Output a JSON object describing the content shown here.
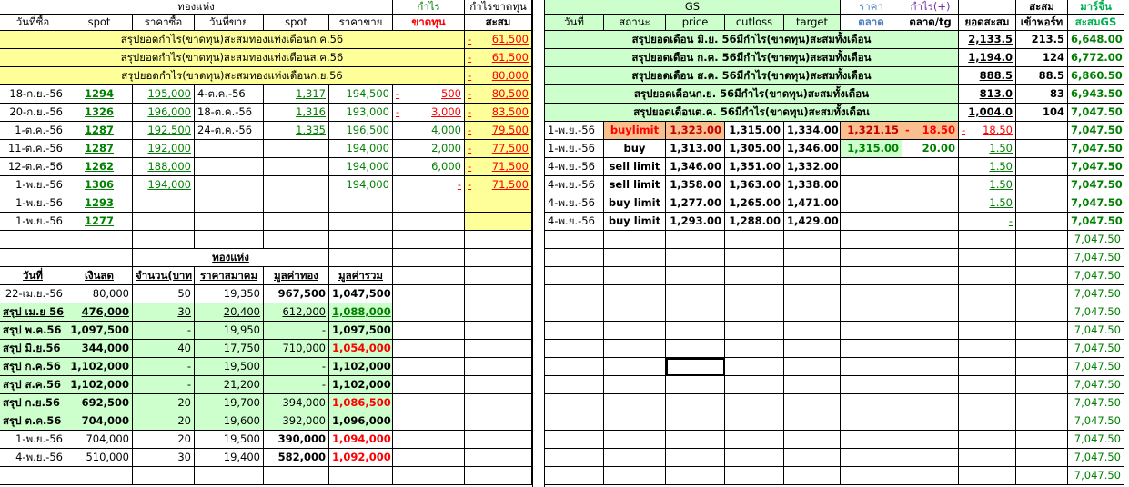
{
  "left": {
    "group_headers": {
      "gold_bar": "ทองแห่ง",
      "profit": "กำไร",
      "profit_loss": "กำไรขาดทุน"
    },
    "headers": [
      "วันที่ซื้อ",
      "spot",
      "ราคาซื้อ",
      "วันที่ขาย",
      "spot",
      "ราคาขาย",
      "ขาดทุน",
      "สะสม"
    ],
    "summaries": [
      {
        "label": "สรุปยอดกำไร(ขาดทุน)สะสมทองแท่งเดือนก.ค.56",
        "dash": "-",
        "value": "61,500"
      },
      {
        "label": "สรุปยอดกำไร(ขาดทุน)สะสมทองแท่งเดือนส.ค.56",
        "dash": "-",
        "value": "61,500"
      },
      {
        "label": "สรุปยอดกำไร(ขาดทุน)สะสมทองแท่งเดือนก.ย.56",
        "dash": "-",
        "value": "80,000"
      }
    ],
    "rows": [
      {
        "buy_date": "18-ก.ย.-56",
        "spot": "1294",
        "buy_price": "195,000",
        "sell_date": "4-ต.ค.-56",
        "sell_spot": "1,317",
        "sell_price": "194,500",
        "pl_dash": "-",
        "pl": "500",
        "cum_dash": "-",
        "cum": "80,500"
      },
      {
        "buy_date": "20-ก.ย.-56",
        "spot": "1326",
        "buy_price": "196,000",
        "sell_date": "18-ต.ค.-56",
        "sell_spot": "1,316",
        "sell_price": "193,000",
        "pl_dash": "-",
        "pl": "3,000",
        "cum_dash": "-",
        "cum": "83,500"
      },
      {
        "buy_date": "1-ต.ค.-56",
        "spot": "1287",
        "buy_price": "192,500",
        "sell_date": "24-ต.ค.-56",
        "sell_spot": "1,335",
        "sell_price": "196,500",
        "pl_dash": "",
        "pl": "4,000",
        "cum_dash": "-",
        "cum": "79,500"
      },
      {
        "buy_date": "11-ต.ค.-56",
        "spot": "1287",
        "buy_price": "192,000",
        "sell_date": "",
        "sell_spot": "",
        "sell_price": "194,000",
        "pl_dash": "",
        "pl": "2,000",
        "cum_dash": "-",
        "cum": "77,500"
      },
      {
        "buy_date": "12-ต.ค.-56",
        "spot": "1262",
        "buy_price": "188,000",
        "sell_date": "",
        "sell_spot": "",
        "sell_price": "194,000",
        "pl_dash": "",
        "pl": "6,000",
        "cum_dash": "-",
        "cum": "71,500"
      },
      {
        "buy_date": "1-พ.ย.-56",
        "spot": "1306",
        "buy_price": "194,000",
        "sell_date": "",
        "sell_spot": "",
        "sell_price": "194,000",
        "pl_dash": "",
        "pl": "-",
        "cum_dash": "-",
        "cum": "71,500"
      },
      {
        "buy_date": "1-พ.ย.-56",
        "spot": "1293",
        "buy_price": "",
        "sell_date": "",
        "sell_spot": "",
        "sell_price": "",
        "pl_dash": "",
        "pl": "",
        "cum_dash": "",
        "cum": ""
      },
      {
        "buy_date": "1-พ.ย.-56",
        "spot": "1277",
        "buy_price": "",
        "sell_date": "",
        "sell_spot": "",
        "sell_price": "",
        "pl_dash": "",
        "pl": "",
        "cum_dash": "",
        "cum": ""
      }
    ],
    "table2": {
      "title": "ทองแห่ง",
      "headers": [
        "วันที่",
        "เงินสด",
        "จำนวน(บาท",
        "ราคาสมาคม",
        "มูลค่าทอง",
        "มูลค่ารวม"
      ],
      "rows": [
        {
          "date": "22-เม.ย.-56",
          "cash": "80,000",
          "qty": "50",
          "price": "19,350",
          "gold": "967,500",
          "total": "1,047,500",
          "kind": "plain"
        },
        {
          "date": "สรุป เม.ย 56",
          "cash": "476,000",
          "qty": "30",
          "price": "20,400",
          "gold": "612,000",
          "total": "1,088,000",
          "kind": "sum-ul"
        },
        {
          "date": "สรุป พ.ค.56",
          "cash": "1,097,500",
          "qty": "-",
          "price": "19,950",
          "gold": "-",
          "total": "1,097,500",
          "kind": "sum"
        },
        {
          "date": "สรุป มิ.ย.56",
          "cash": "344,000",
          "qty": "40",
          "price": "17,750",
          "gold": "710,000",
          "total": "1,054,000",
          "kind": "sum-red"
        },
        {
          "date": "สรุป ก.ค.56",
          "cash": "1,102,000",
          "qty": "-",
          "price": "19,500",
          "gold": "-",
          "total": "1,102,000",
          "kind": "sum"
        },
        {
          "date": "สรุป ส.ค.56",
          "cash": "1,102,000",
          "qty": "-",
          "price": "21,200",
          "gold": "-",
          "total": "1,102,000",
          "kind": "sum"
        },
        {
          "date": "สรุป ก.ย.56",
          "cash": "692,500",
          "qty": "20",
          "price": "19,700",
          "gold": "394,000",
          "total": "1,086,500",
          "kind": "sum-red"
        },
        {
          "date": "สรุป ต.ค.56",
          "cash": "704,000",
          "qty": "20",
          "price": "19,600",
          "gold": "392,000",
          "total": "1,096,000",
          "kind": "sum"
        },
        {
          "date": "1-พ.ย.-56",
          "cash": "704,000",
          "qty": "20",
          "price": "19,500",
          "gold": "390,000",
          "total": "1,094,000",
          "kind": "plain-red"
        },
        {
          "date": "4-พ.ย.-56",
          "cash": "510,000",
          "qty": "30",
          "price": "19,400",
          "gold": "582,000",
          "total": "1,092,000",
          "kind": "plain-red"
        }
      ]
    }
  },
  "right": {
    "group_headers": {
      "gs": "GS",
      "price": "ราคา",
      "profit": "กำไร(+)",
      "cum": "สะสม",
      "margin": "มาร์จิ้น"
    },
    "headers": [
      "วันที่",
      "สถานะ",
      "price",
      "cutloss",
      "target",
      "ตลาด",
      "ตลาด/tg",
      "ยอดสะสม",
      "เข้าพอร์ท",
      "สะสมGS"
    ],
    "summaries": [
      {
        "label": "สรุปยอดเดือน มิ.ย. 56มีกำไร(ขาดทุน)สะสมทั้งเดือน",
        "cum": "2,133.5",
        "port": "213.5",
        "gs": "6,648.00"
      },
      {
        "label": "สรุปยอดเดือน ก.ค. 56มีกำไร(ขาดทุน)สะสมทั้งเดือน",
        "cum": "1,194.0",
        "port": "124",
        "gs": "6,772.00"
      },
      {
        "label": "สรุปยอดเดือน ส.ค. 56มีกำไร(ขาดทุน)สะสมทั้งเดือน",
        "cum": "888.5",
        "port": "88.5",
        "gs": "6,860.50"
      },
      {
        "label": "สรุปยอดเดือนก.ย. 56มีกำไร(ขาดทุน)สะสมทั้งเดือน",
        "cum": "813.0",
        "port": "83",
        "gs": "6,943.50"
      },
      {
        "label": "สรุปยอดเดือนต.ค. 56มีกำไร(ขาดทุน)สะสมทั้งเดือน",
        "cum": "1,004.0",
        "port": "104",
        "gs": "7,047.50"
      }
    ],
    "trades": [
      {
        "date": "1-พ.ย.-56",
        "status": "buylimit",
        "price": "1,323.00",
        "cutloss": "1,315.00",
        "target": "1,334.00",
        "market": "1,321.15",
        "mtg_dash": "-",
        "mtg": "18.50",
        "cum_dash": "-",
        "cum": "18.50",
        "gs": "7,047.50"
      },
      {
        "date": "1-พ.ย.-56",
        "status": "buy",
        "price": "1,313.00",
        "cutloss": "1,305.00",
        "target": "1,346.00",
        "market": "1,315.00",
        "mtg_dash": "",
        "mtg": "20.00",
        "cum_dash": "",
        "cum": "1.50",
        "gs": "7,047.50"
      },
      {
        "date": "4-พ.ย.-56",
        "status": "sell limit",
        "price": "1,346.00",
        "cutloss": "1,351.00",
        "target": "1,332.00",
        "market": "",
        "mtg_dash": "",
        "mtg": "",
        "cum_dash": "",
        "cum": "1.50",
        "gs": "7,047.50"
      },
      {
        "date": "4-พ.ย.-56",
        "status": "sell limit",
        "price": "1,358.00",
        "cutloss": "1,363.00",
        "target": "1,338.00",
        "market": "",
        "mtg_dash": "",
        "mtg": "",
        "cum_dash": "",
        "cum": "1.50",
        "gs": "7,047.50"
      },
      {
        "date": "4-พ.ย.-56",
        "status": "buy limit",
        "price": "1,277.00",
        "cutloss": "1,265.00",
        "target": "1,471.00",
        "market": "",
        "mtg_dash": "",
        "mtg": "",
        "cum_dash": "",
        "cum": "1.50",
        "gs": "7,047.50"
      },
      {
        "date": "4-พ.ย.-56",
        "status": "buy limit",
        "price": "1,293.00",
        "cutloss": "1,288.00",
        "target": "1,429.00",
        "market": "",
        "mtg_dash": "",
        "mtg": "",
        "cum_dash": "",
        "cum": "-",
        "gs": "7,047.50"
      }
    ],
    "gs_tail": [
      "7,047.50",
      "7,047.50",
      "7,047.50",
      "7,047.50",
      "7,047.50",
      "7,047.50",
      "7,047.50",
      "7,047.50",
      "7,047.50",
      "7,047.50",
      "7,047.50",
      "7,047.50",
      "7,047.50",
      "7,047.50"
    ]
  }
}
